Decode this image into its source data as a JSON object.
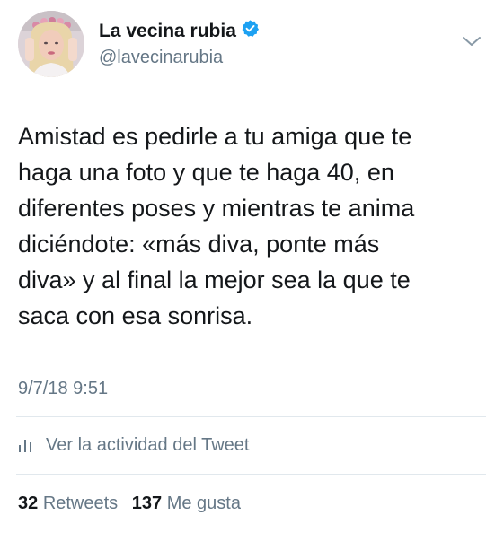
{
  "tweet": {
    "author": {
      "display_name": "La vecina rubia",
      "handle": "@lavecinarubia",
      "verified": true,
      "avatar_icon": "profile-photo-avatar"
    },
    "text": "Amistad es pedirle a tu amiga que te\nhaga una foto y que te haga 40, en\ndiferentes poses y mientras te anima\ndiciéndote: «más diva, ponte más\ndiva» y al final la mejor sea la que te\nsaca con esa sonrisa.",
    "timestamp": "9/7/18 9:51",
    "activity_label": "Ver la actividad del Tweet",
    "stats": {
      "retweets_count": "32",
      "retweets_label": "Retweets",
      "likes_count": "137",
      "likes_label": "Me gusta"
    }
  },
  "colors": {
    "text_primary": "#14171a",
    "text_secondary": "#657786",
    "verified_blue": "#1da1f2",
    "divider": "#e1e8ed"
  },
  "icons": {
    "verified": "verified-badge-icon",
    "menu": "chevron-down-icon",
    "activity": "bar-chart-icon"
  }
}
